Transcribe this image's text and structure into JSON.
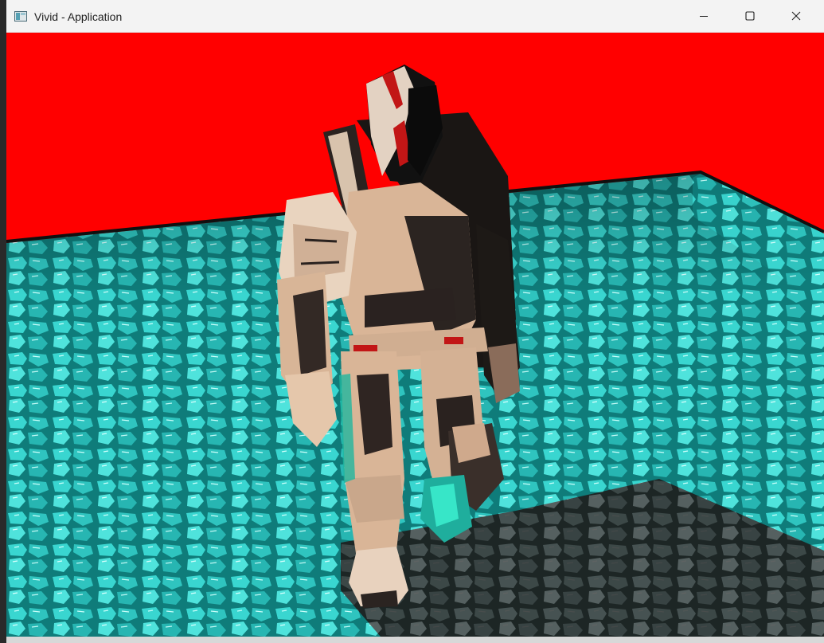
{
  "window": {
    "title": "Vivid - Application",
    "controls": [
      "minimize",
      "maximize",
      "close"
    ]
  },
  "viewport": {
    "icons": {
      "app": "app-window-icon",
      "minimize": "minimize-icon",
      "maximize": "maximize-icon",
      "close": "close-icon"
    },
    "colors": {
      "background": "#ff0000",
      "floor": "#2ec9c4",
      "floor_dark": "#0c6f6e",
      "shadow": "#353535",
      "armor": "#d8b79a",
      "armor_dark": "#2d2420",
      "accent": "#b61212"
    },
    "scene": "3d-character-render"
  }
}
